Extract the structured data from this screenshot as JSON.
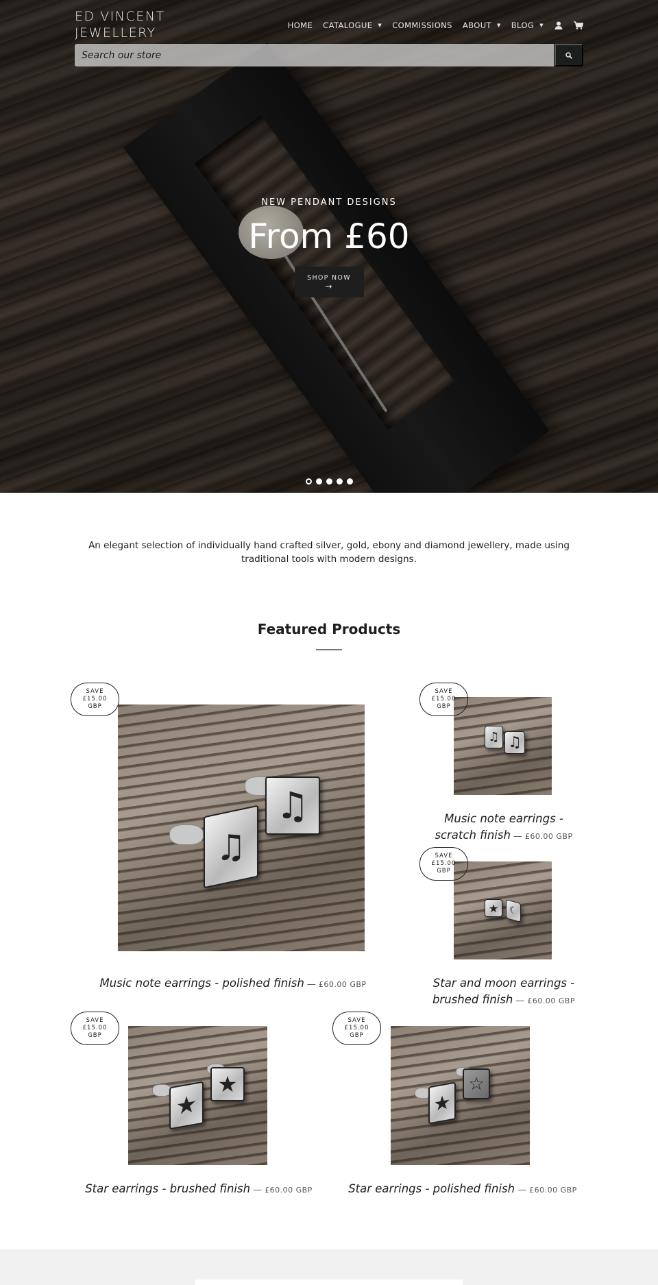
{
  "header": {
    "logo_line1": "ED VINCENT",
    "logo_line2": "JEWELLERY",
    "nav": [
      {
        "label": "HOME",
        "has_dropdown": false
      },
      {
        "label": "CATALOGUE",
        "has_dropdown": true
      },
      {
        "label": "COMMISSIONS",
        "has_dropdown": false
      },
      {
        "label": "ABOUT",
        "has_dropdown": true
      },
      {
        "label": "BLOG",
        "has_dropdown": true
      }
    ],
    "account_icon": "user-icon",
    "cart_icon": "cart-icon",
    "search": {
      "placeholder": "Search our store",
      "button_icon": "search-icon"
    }
  },
  "hero": {
    "subtitle": "NEW PENDANT DESIGNS",
    "title": "From £60",
    "button_label": "SHOP NOW",
    "button_arrow": "→",
    "slides_total": 5,
    "active_slide": 1
  },
  "intro": {
    "text": "An elegant selection of individually hand crafted silver, gold, ebony and diamond jewellery, made using traditional tools with modern designs."
  },
  "featured": {
    "title": "Featured Products",
    "products": [
      {
        "title": "Music note earrings - polished finish",
        "price": "£60.00 GBP",
        "badge_line1": "SAVE",
        "badge_line2": "£15.00",
        "badge_line3": "GBP"
      },
      {
        "title": "Music note earrings - scratch finish",
        "price": "£60.00 GBP",
        "badge_line1": "SAVE",
        "badge_line2": "£15.00",
        "badge_line3": "GBP"
      },
      {
        "title": "Star and moon earrings - brushed finish",
        "price": "£60.00 GBP",
        "badge_line1": "SAVE",
        "badge_line2": "£15.00",
        "badge_line3": "GBP"
      },
      {
        "title": "Star earrings - brushed finish",
        "price": "£60.00 GBP",
        "badge_line1": "SAVE",
        "badge_line2": "£15.00",
        "badge_line3": "GBP"
      },
      {
        "title": "Star earrings - polished finish",
        "price": "£60.00 GBP",
        "badge_line1": "SAVE",
        "badge_line2": "£15.00",
        "badge_line3": "GBP"
      }
    ],
    "dash": "—"
  },
  "colors": {
    "text": "#1c1d1d",
    "button_dark": "#1e1e1e",
    "footer_bg": "#f1f1f1"
  }
}
